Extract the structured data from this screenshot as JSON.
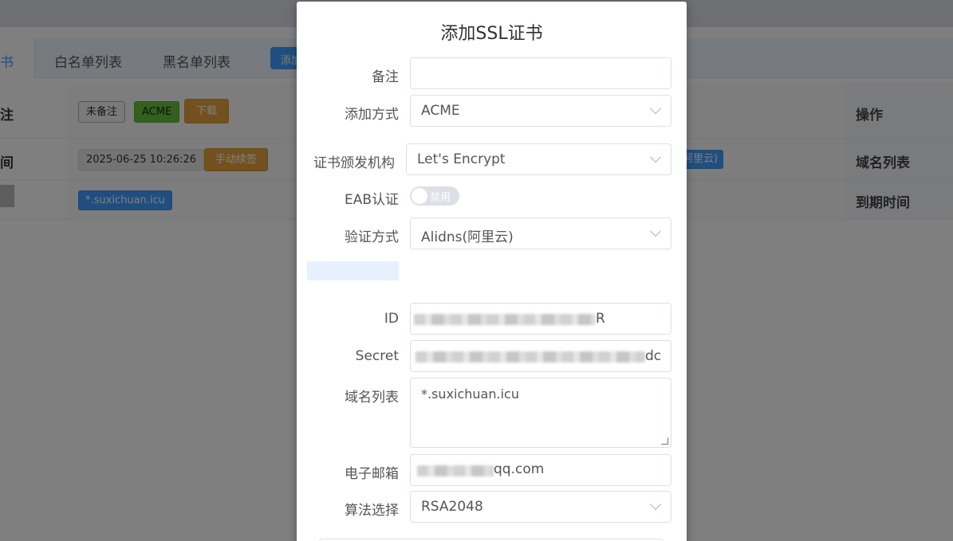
{
  "background": {
    "tabs": [
      "书",
      "白名单列表",
      "黑名单列表"
    ],
    "add_button_fragment": "添加",
    "rows": [
      {
        "key": "注",
        "op": "操作",
        "tags": [
          "未备注",
          "ACME",
          "下载"
        ]
      },
      {
        "key": "间",
        "op": "域名列表",
        "tags": [
          "2025-06-25 10:26:26",
          "手动续签"
        ],
        "right_tag": "阿里云)"
      },
      {
        "key": "",
        "op": "到期时间",
        "tags": [
          "*.suxichuan.icu"
        ]
      }
    ]
  },
  "dialog": {
    "title": "添加SSL证书",
    "fields": {
      "remark": {
        "label": "备注",
        "value": ""
      },
      "add_method": {
        "label": "添加方式",
        "value": "ACME"
      },
      "ca": {
        "label": "证书颁发机构",
        "value": "Let's Encrypt"
      },
      "eab": {
        "label": "EAB认证",
        "value": "禁用"
      },
      "verify": {
        "label": "验证方式",
        "value": "Alidns(阿里云)"
      },
      "id": {
        "label": "ID",
        "value_suffix": "R"
      },
      "secret": {
        "label": "Secret",
        "value_suffix": "dc"
      },
      "domains": {
        "label": "域名列表",
        "value": "*.suxichuan.icu"
      },
      "email": {
        "label": "电子邮箱",
        "value_suffix": "qq.com"
      },
      "algorithm": {
        "label": "算法选择",
        "value": "RSA2048"
      }
    }
  },
  "colors": {
    "primary": "#409eff",
    "success": "#67c23a",
    "warning": "#e6a23c",
    "mask": "rgba(0,0,0,0.5)"
  }
}
